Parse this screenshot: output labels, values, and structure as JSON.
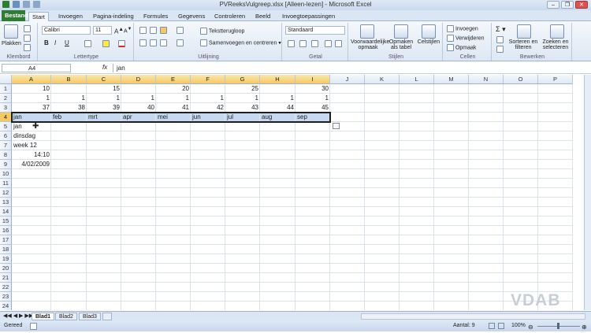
{
  "window": {
    "title": "PVReeksVulgreep.xlsx  [Alleen-lezen]  -  Microsoft Excel",
    "minimize": "–",
    "restore": "❐",
    "close": "✕"
  },
  "ribbon_tabs": {
    "file": "Bestand",
    "items": [
      "Start",
      "Invoegen",
      "Pagina-indeling",
      "Formules",
      "Gegevens",
      "Controleren",
      "Beeld",
      "Invoegtoepassingen"
    ]
  },
  "ribbon": {
    "clipboard": {
      "paste": "Plakken",
      "label": "Klembord"
    },
    "font": {
      "name": "Calibri",
      "size": "11",
      "bold": "B",
      "italic": "I",
      "underline": "U",
      "label": "Lettertype"
    },
    "alignment": {
      "wrap": "Tekstterugloop",
      "merge": "Samenvoegen en centreren",
      "label": "Uitlijning"
    },
    "number": {
      "format": "Standaard",
      "label": "Getal"
    },
    "styles": {
      "conditional": "Voorwaardelijke opmaak",
      "table": "Opmaken als tabel",
      "cell": "Celstijlen",
      "label": "Stijlen"
    },
    "cells": {
      "insert": "Invoegen",
      "delete": "Verwijderen",
      "format": "Opmaak",
      "label": "Cellen"
    },
    "editing": {
      "sort": "Sorteren en filteren",
      "find": "Zoeken en selecteren",
      "label": "Bewerken"
    }
  },
  "formula_bar": {
    "name_box": "A4",
    "fx": "fx",
    "value": "jan"
  },
  "columns": [
    "A",
    "B",
    "C",
    "D",
    "E",
    "F",
    "G",
    "H",
    "I",
    "J",
    "K",
    "L",
    "M",
    "N",
    "O",
    "P"
  ],
  "rows": [
    "1",
    "2",
    "3",
    "4",
    "5",
    "6",
    "7",
    "8",
    "9",
    "10",
    "11",
    "12",
    "13",
    "14",
    "15",
    "16",
    "17",
    "18",
    "19",
    "20",
    "21",
    "22",
    "23",
    "24"
  ],
  "cells": {
    "row1": [
      "10",
      "",
      "15",
      "",
      "20",
      "",
      "25",
      "",
      "30"
    ],
    "row2": [
      "1",
      "1",
      "1",
      "1",
      "1",
      "1",
      "1",
      "1",
      "1"
    ],
    "row3": [
      "37",
      "38",
      "39",
      "40",
      "41",
      "42",
      "43",
      "44",
      "45"
    ],
    "row4": [
      "jan",
      "feb",
      "mrt",
      "apr",
      "mei",
      "jun",
      "jul",
      "aug",
      "sep"
    ],
    "A5": "jan",
    "A6": "dinsdag",
    "A7": "week 12",
    "A8": "14:10",
    "A9": "4/02/2009"
  },
  "sheets": [
    "Blad1",
    "Blad2",
    "Blad3"
  ],
  "status": {
    "ready": "Gereed",
    "count": "Aantal: 9",
    "zoom": "100%"
  },
  "watermark": "VDAB"
}
